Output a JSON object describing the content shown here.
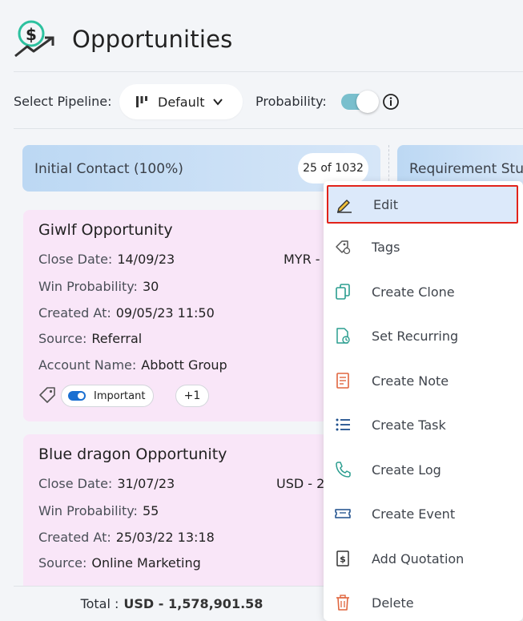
{
  "header": {
    "title": "Opportunities"
  },
  "pipeline": {
    "label": "Select Pipeline:",
    "selected": "Default",
    "probability_label": "Probability:",
    "probability_on": true
  },
  "columns": [
    {
      "name": "Initial Contact (100%)",
      "count": "25 of 1032"
    },
    {
      "name": "Requirement Stu"
    }
  ],
  "cards": [
    {
      "title": "Giwlf Opportunity",
      "close_date_label": "Close Date:",
      "close_date": "14/09/23",
      "amount": "MYR -",
      "win_prob_label": "Win Probability:",
      "win_prob": "30",
      "created_label": "Created At:",
      "created": "09/05/23 11:50",
      "source_label": "Source:",
      "source": "Referral",
      "account_label": "Account Name:",
      "account": "Abbott Group",
      "tag": "Important",
      "more_tags": "+1"
    },
    {
      "title": "Blue dragon Opportunity",
      "close_date_label": "Close Date:",
      "close_date": "31/07/23",
      "amount": "USD - 2",
      "win_prob_label": "Win Probability:",
      "win_prob": "55",
      "created_label": "Created At:",
      "created": "25/03/22 13:18",
      "source_label": "Source:",
      "source": "Online Marketing"
    }
  ],
  "footer": {
    "total_label": "Total :",
    "total_value": "USD - 1,578,901.58"
  },
  "menu": {
    "items": [
      {
        "label": "Edit",
        "icon": "pencil-icon"
      },
      {
        "label": "Tags",
        "icon": "tags-icon"
      },
      {
        "label": "Create Clone",
        "icon": "clone-icon"
      },
      {
        "label": "Set Recurring",
        "icon": "recurring-icon"
      },
      {
        "label": "Create Note",
        "icon": "note-icon"
      },
      {
        "label": "Create Task",
        "icon": "task-icon"
      },
      {
        "label": "Create Log",
        "icon": "phone-icon"
      },
      {
        "label": "Create Event",
        "icon": "ticket-icon"
      },
      {
        "label": "Add Quotation",
        "icon": "quotation-icon"
      },
      {
        "label": "Delete",
        "icon": "trash-icon"
      }
    ],
    "highlighted": "Edit"
  },
  "colors": {
    "accent": "#1a6fd1",
    "card_bg": "#f9e6f8",
    "highlight_border": "#e2231a",
    "toggle": "#79bfcd"
  }
}
